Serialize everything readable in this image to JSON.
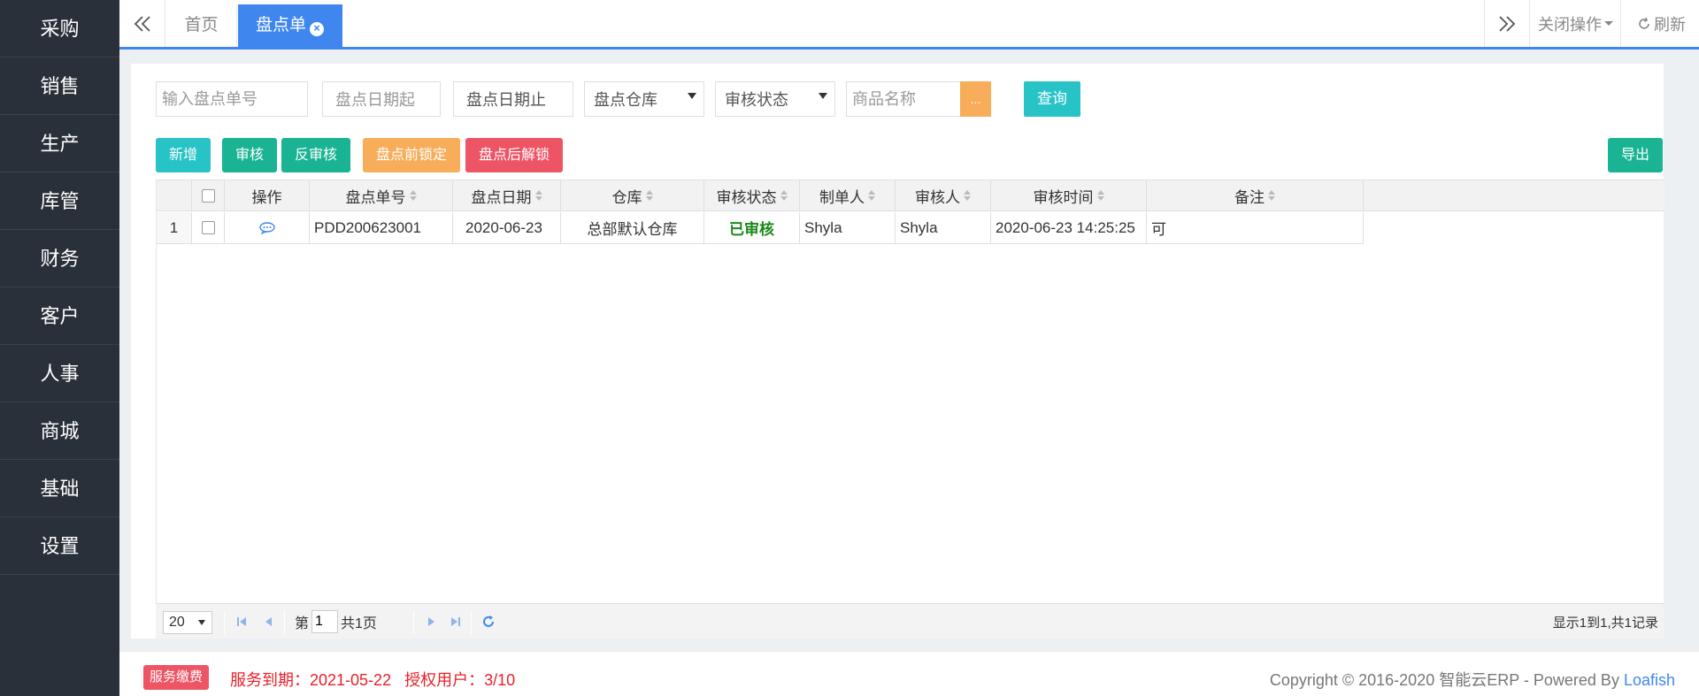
{
  "sidebar": {
    "items": [
      "采购",
      "销售",
      "生产",
      "库管",
      "财务",
      "客户",
      "人事",
      "商城",
      "基础",
      "设置"
    ]
  },
  "topbar": {
    "home_tab": "首页",
    "active_tab": "盘点单",
    "close_ops": "关闭操作",
    "refresh": "刷新"
  },
  "filters": {
    "order_no_placeholder": "输入盘点单号",
    "date_from_placeholder": "盘点日期起",
    "date_to_placeholder": "盘点日期止",
    "warehouse": "盘点仓库",
    "audit_status": "审核状态",
    "product_placeholder": "商品名称",
    "dots": "...",
    "query": "查询"
  },
  "toolbar": {
    "add": "新增",
    "audit": "审核",
    "unaudit": "反审核",
    "lock_before": "盘点前锁定",
    "unlock_after": "盘点后解锁",
    "export": "导出"
  },
  "grid": {
    "columns": [
      "操作",
      "盘点单号",
      "盘点日期",
      "仓库",
      "审核状态",
      "制单人",
      "审核人",
      "审核时间",
      "备注"
    ],
    "rows": [
      {
        "index": "1",
        "order_no": "PDD200623001",
        "date": "2020-06-23",
        "warehouse": "总部默认仓库",
        "status": "已审核",
        "creator": "Shyla",
        "auditor": "Shyla",
        "audit_time": "2020-06-23 14:25:25",
        "remark": "可"
      }
    ]
  },
  "pager": {
    "page_size": "20",
    "page_prefix": "第",
    "page_value": "1",
    "page_suffix": "共1页",
    "summary": "显示1到1,共1记录"
  },
  "footer": {
    "fee_badge": "服务缴费",
    "expiry": "服务到期：2021-05-22   授权用户：3/10",
    "copyright": "Copyright © 2016-2020 智能云ERP - Powered By ",
    "brand": "Loafish"
  },
  "colors": {
    "sidebar_bg": "#2a3039",
    "accent_blue": "#3f87ef",
    "teal": "#28c3c6",
    "green": "#1ab394",
    "orange": "#f7ad59",
    "red": "#ed5565"
  }
}
